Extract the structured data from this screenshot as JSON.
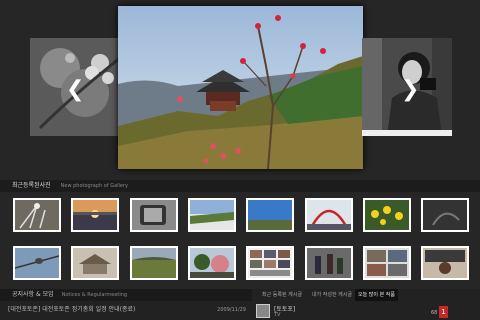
{
  "slider": {
    "prev_arrow": "❮",
    "next_arrow": "❯",
    "slides": [
      {
        "position": "left",
        "icon": "flower-branch-bw"
      },
      {
        "position": "center",
        "icon": "pavilion-hill-blossoms"
      },
      {
        "position": "right",
        "icon": "woman-photographer-bw"
      }
    ]
  },
  "gallery": {
    "title": "최근등록된사진",
    "subtitle": "New photograph of Gallery",
    "rows": [
      [
        "frost-plant",
        "sunset-lake",
        "old-tv",
        "snow-field",
        "blue-sky-field",
        "red-arch-bridge",
        "yellow-flowers",
        "dark-abstract"
      ],
      [
        "bird-branch",
        "old-house",
        "field-landscape",
        "pink-tree",
        "collage-people",
        "people-street",
        "collage-group",
        "person-portrait"
      ]
    ]
  },
  "notices": {
    "title": "공지사항 & 모임",
    "subtitle": "Notices & Regularmeeting",
    "item": "[대전포토존] 대전포토존 정기총회 일정 안내(종료)",
    "date": "2009/11/29"
  },
  "tabs": [
    "최근 등록된 게시글",
    "내가 작성한 게시글",
    "오늘 많이 본 작품"
  ],
  "active_tab": 2,
  "post": {
    "name": "[토토포]",
    "sub": "TV",
    "count": "68",
    "badge": "1"
  },
  "colors": {
    "background": "#262626",
    "accent_badge": "#c62828"
  }
}
